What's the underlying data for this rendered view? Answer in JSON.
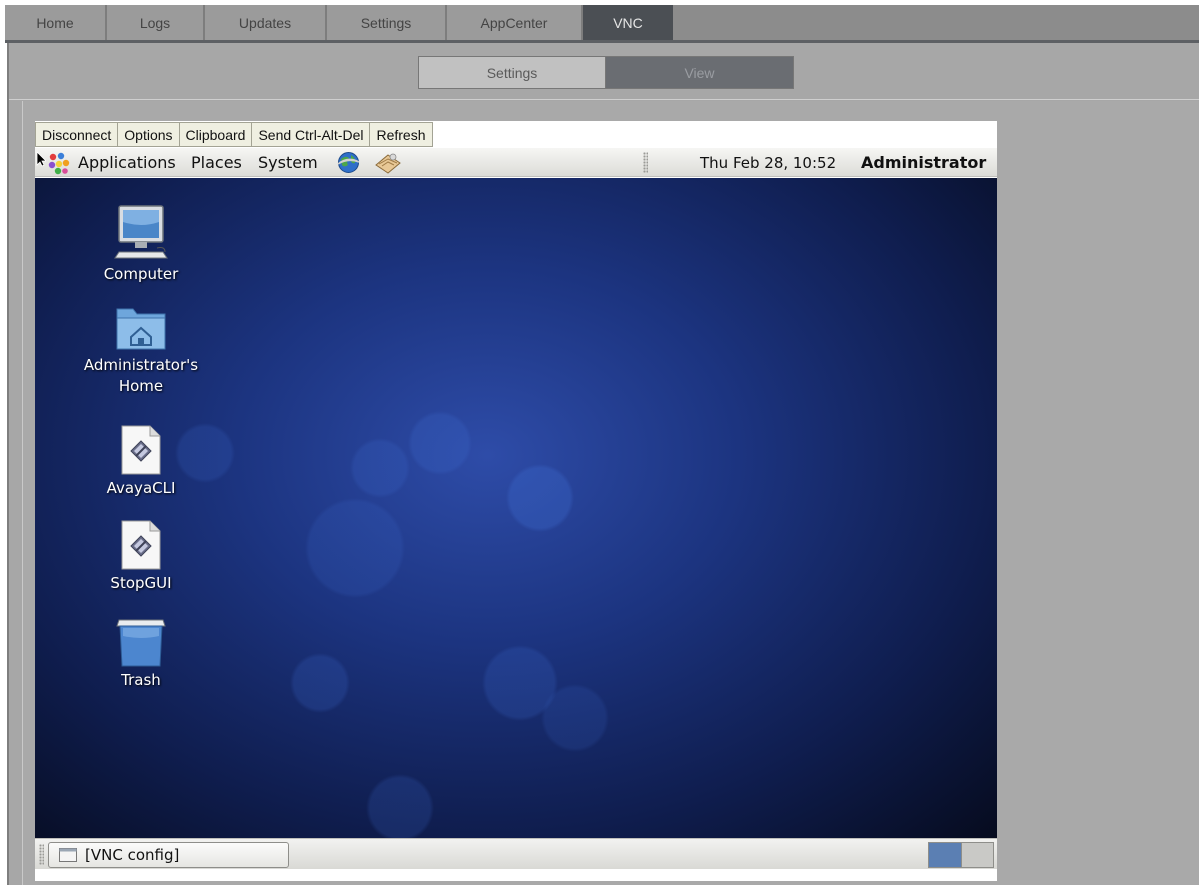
{
  "tabs": {
    "home": "Home",
    "logs": "Logs",
    "updates": "Updates",
    "settings": "Settings",
    "appcenter": "AppCenter",
    "vnc": "VNC"
  },
  "subtabs": {
    "settings": "Settings",
    "view": "View"
  },
  "vnc_toolbar": {
    "disconnect": "Disconnect",
    "options": "Options",
    "clipboard": "Clipboard",
    "send_cad": "Send Ctrl-Alt-Del",
    "refresh": "Refresh"
  },
  "gnome_panel": {
    "applications": "Applications",
    "places": "Places",
    "system": "System",
    "clock": "Thu Feb 28, 10:52",
    "user": "Administrator"
  },
  "desktop_icons": {
    "computer": "Computer",
    "home_line1": "Administrator's",
    "home_line2": "Home",
    "avayacli": "AvayaCLI",
    "stopgui": "StopGUI",
    "trash": "Trash"
  },
  "taskbar": {
    "window": "[VNC config]"
  },
  "colors": {
    "active_tab": "#4b4f54",
    "desktop_blue": "#1c3480",
    "workspace_active": "#5b7fb3"
  }
}
